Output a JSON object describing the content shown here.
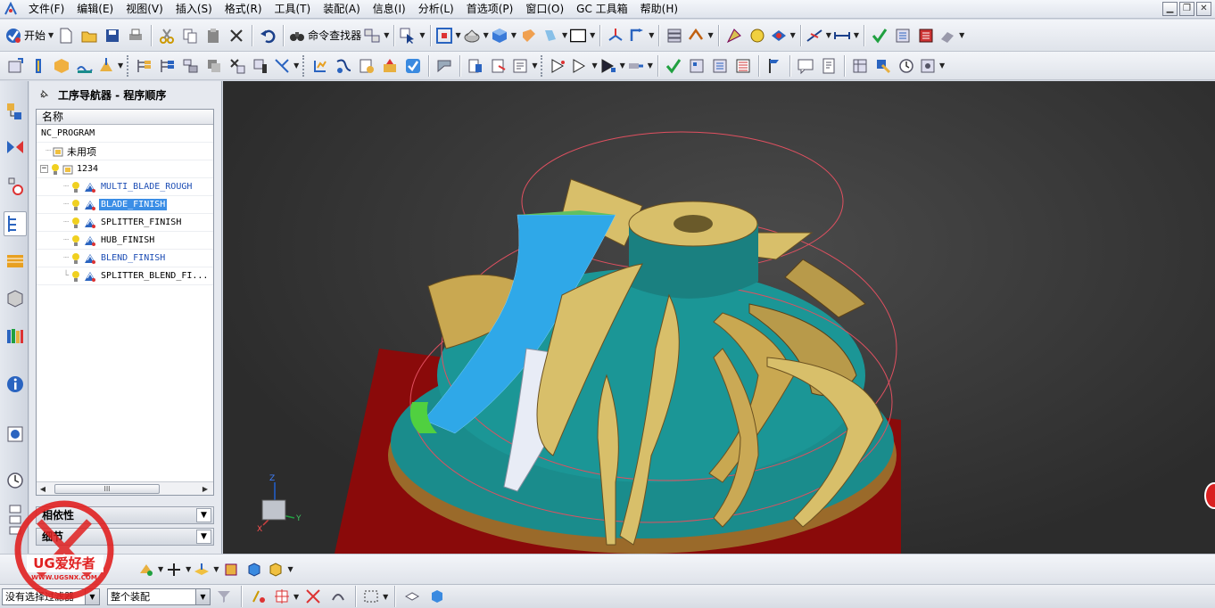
{
  "menubar": {
    "items": [
      "文件(F)",
      "编辑(E)",
      "视图(V)",
      "插入(S)",
      "格式(R)",
      "工具(T)",
      "装配(A)",
      "信息(I)",
      "分析(L)",
      "首选项(P)",
      "窗口(O)",
      "GC 工具箱",
      "帮助(H)"
    ]
  },
  "toolbar1": {
    "start_label": "开始",
    "command_finder_label": "命令查找器"
  },
  "navigator": {
    "title": "工序导航器 - 程序顺序",
    "column_name": "名称",
    "scroll_thumb": "III",
    "tree": {
      "root": "NC_PROGRAM",
      "unused": "未用项",
      "program": "1234",
      "operations": [
        "MULTI_BLADE_ROUGH",
        "BLADE_FINISH",
        "SPLITTER_FINISH",
        "HUB_FINISH",
        "BLEND_FINISH",
        "SPLITTER_BLEND_FI..."
      ],
      "selected": "BLADE_FINISH"
    },
    "dependencies_label": "相依性",
    "details_label": "细节"
  },
  "statusbar": {
    "selection_filter": "没有选择过滤器",
    "assembly_scope": "整个装配"
  },
  "watermark": {
    "brand": "UG爱好者",
    "url": "WWW.UGSNX.COM"
  },
  "viewport": {
    "triad_labels": [
      "Z",
      "Y",
      "X"
    ],
    "model_colors": {
      "blade": "#d8bf6a",
      "hub": "#1a8c8c",
      "stock": "#8a0a0a",
      "toolpath": "#2fa8e8",
      "bounds": "#e05060"
    }
  }
}
